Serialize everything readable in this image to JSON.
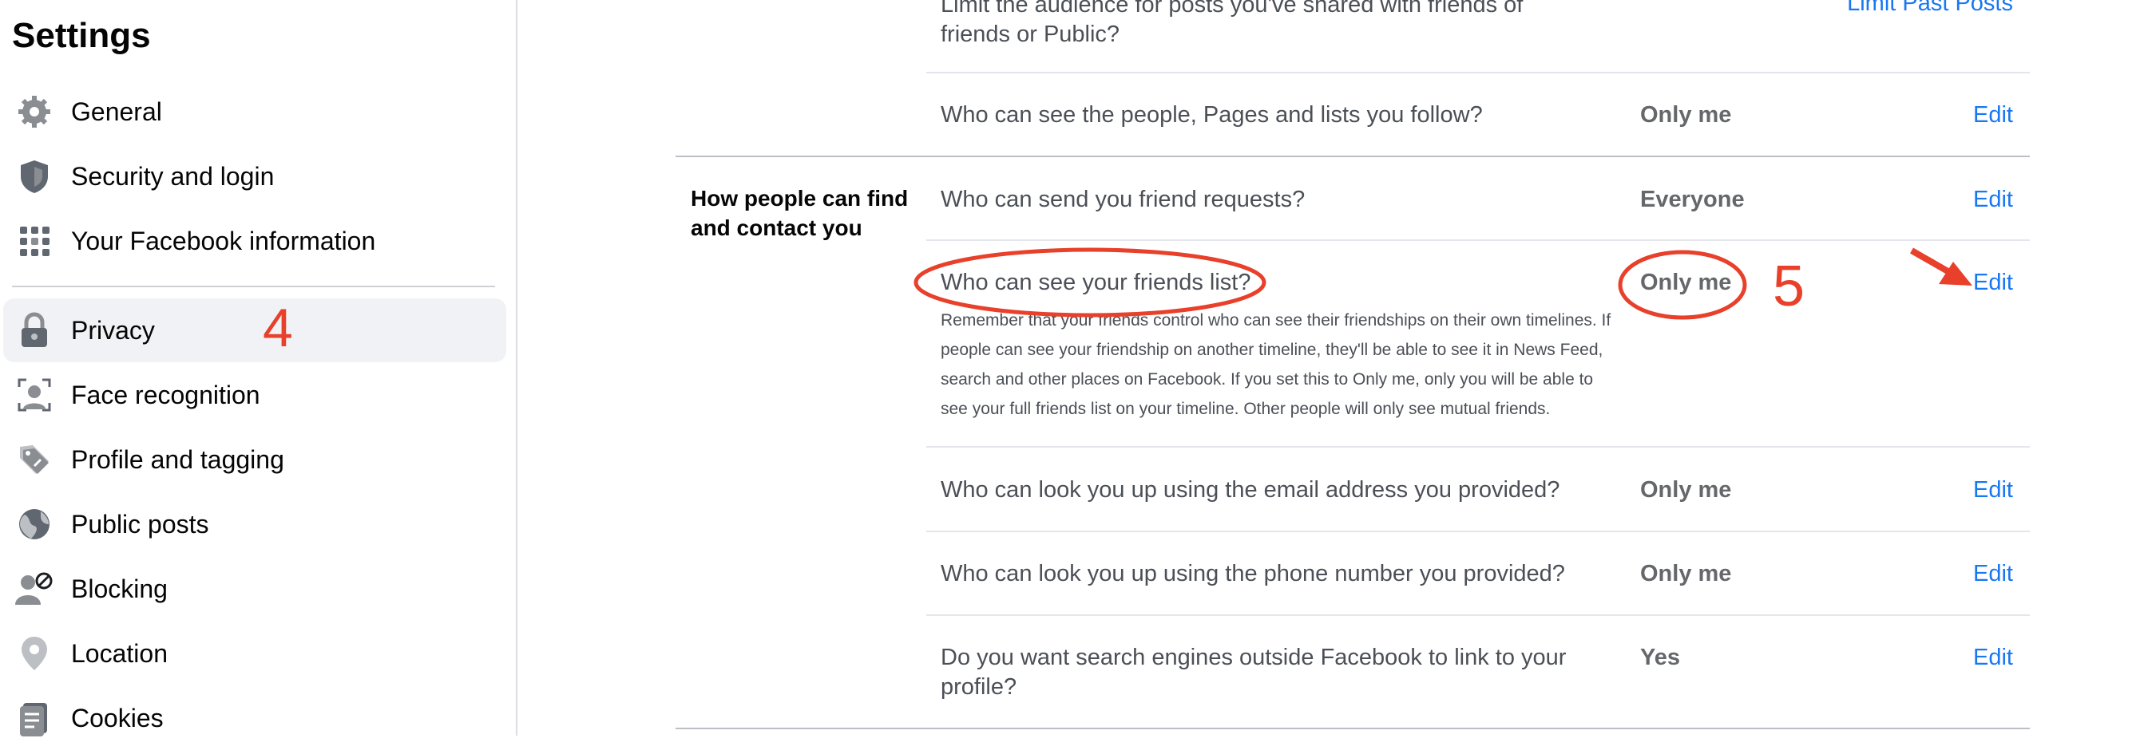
{
  "sidebar": {
    "title": "Settings",
    "items": [
      {
        "label": "General",
        "icon": "gear-icon"
      },
      {
        "label": "Security and login",
        "icon": "shield-icon"
      },
      {
        "label": "Your Facebook information",
        "icon": "grid-icon"
      },
      {
        "label": "Privacy",
        "icon": "lock-icon",
        "active": true
      },
      {
        "label": "Face recognition",
        "icon": "face-scan-icon"
      },
      {
        "label": "Profile and tagging",
        "icon": "tag-icon"
      },
      {
        "label": "Public posts",
        "icon": "globe-icon"
      },
      {
        "label": "Blocking",
        "icon": "blocked-user-icon"
      },
      {
        "label": "Location",
        "icon": "location-pin-icon"
      },
      {
        "label": "Cookies",
        "icon": "cookie-doc-icon"
      }
    ]
  },
  "main": {
    "top_partial_question": "Limit the audience for posts you've shared with friends of friends or Public?",
    "top_partial_action": "Limit Past Posts",
    "follow_row": {
      "question": "Who can see the people, Pages and lists you follow?",
      "value": "Only me",
      "action": "Edit"
    },
    "section_label": "How people can find and contact you",
    "rows": [
      {
        "question": "Who can send you friend requests?",
        "value": "Everyone",
        "action": "Edit"
      },
      {
        "question": "Who can see your friends list?",
        "value": "Only me",
        "action": "Edit",
        "description": "Remember that your friends control who can see their friendships on their own timelines. If people can see your friendship on another timeline, they'll be able to see it in News Feed, search and other places on Facebook. If you set this to Only me, only you will be able to see your full friends list on your timeline. Other people will only see mutual friends."
      },
      {
        "question": "Who can look you up using the email address you provided?",
        "value": "Only me",
        "action": "Edit"
      },
      {
        "question": "Who can look you up using the phone number you provided?",
        "value": "Only me",
        "action": "Edit"
      },
      {
        "question": "Do you want search engines outside Facebook to link to your profile?",
        "value": "Yes",
        "action": "Edit"
      }
    ]
  },
  "annotations": {
    "step_4": "4",
    "step_5": "5"
  },
  "colors": {
    "link": "#1877f2",
    "annotation": "#e8402a",
    "active_bg": "#f0f2f5"
  }
}
